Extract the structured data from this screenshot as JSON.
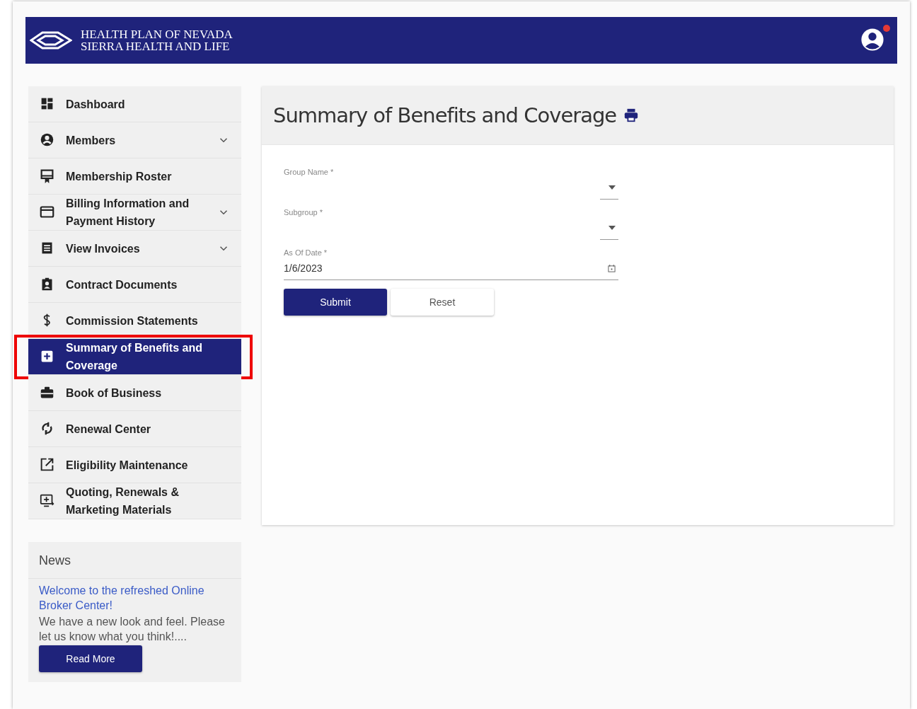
{
  "header": {
    "brand_lines": [
      "HEALTH PLAN OF NEVADA",
      "SIERRA HEALTH AND LIFE"
    ],
    "notification": true
  },
  "sidebar": {
    "items": [
      {
        "label": "Dashboard",
        "expandable": false,
        "selected": false,
        "highlighted": false
      },
      {
        "label": "Members",
        "expandable": true,
        "selected": false,
        "highlighted": false
      },
      {
        "label": "Membership Roster",
        "expandable": false,
        "selected": false,
        "highlighted": false
      },
      {
        "label": "Billing Information and Payment History",
        "expandable": true,
        "selected": false,
        "highlighted": false
      },
      {
        "label": "View Invoices",
        "expandable": true,
        "selected": false,
        "highlighted": false
      },
      {
        "label": "Contract Documents",
        "expandable": false,
        "selected": false,
        "highlighted": false
      },
      {
        "label": "Commission Statements",
        "expandable": false,
        "selected": false,
        "highlighted": false
      },
      {
        "label": "Summary of Benefits and Coverage",
        "expandable": false,
        "selected": true,
        "highlighted": true
      },
      {
        "label": "Book of Business",
        "expandable": false,
        "selected": false,
        "highlighted": false
      },
      {
        "label": "Renewal Center",
        "expandable": false,
        "selected": false,
        "highlighted": false
      },
      {
        "label": "Eligibility Maintenance",
        "expandable": false,
        "selected": false,
        "highlighted": false
      },
      {
        "label": "Quoting, Renewals & Marketing Materials",
        "expandable": false,
        "selected": false,
        "highlighted": false
      }
    ]
  },
  "news": {
    "title": "News",
    "link": "Welcome to the refreshed Online Broker Center!",
    "body": "We have a new look and feel. Please let us know what you think!....",
    "button": "Read More"
  },
  "main": {
    "title": "Summary of Benefits and Coverage",
    "fields": [
      {
        "kind": "select",
        "label": "Group Name *"
      },
      {
        "kind": "select",
        "label": "Subgroup *"
      },
      {
        "kind": "date",
        "label": "As Of Date *",
        "value": "1/6/2023"
      }
    ],
    "buttons": [
      {
        "label": "Submit",
        "kind": "primary"
      },
      {
        "label": "Reset",
        "kind": "secondary"
      }
    ]
  }
}
